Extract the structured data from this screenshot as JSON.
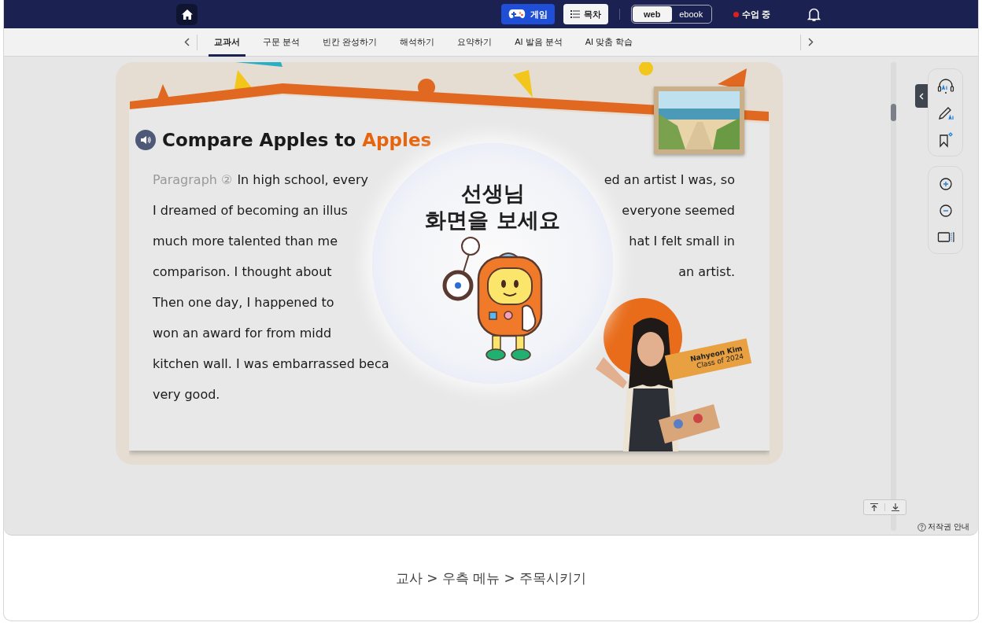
{
  "top_bar": {
    "game_button": "게임",
    "toc_button": "목차",
    "view_toggle": [
      {
        "label": "web",
        "selected": true
      },
      {
        "label": "ebook",
        "selected": false
      }
    ],
    "class_status": {
      "label": "수업 중",
      "live": true
    }
  },
  "tabs": [
    {
      "label": "교과서",
      "selected": true
    },
    {
      "label": "구문 분석",
      "selected": false
    },
    {
      "label": "빈칸 완성하기",
      "selected": false
    },
    {
      "label": "해석하기",
      "selected": false
    },
    {
      "label": "요약하기",
      "selected": false
    },
    {
      "label": "AI 발음 분석",
      "selected": false
    },
    {
      "label": "AI 맞춤 학습",
      "selected": false
    }
  ],
  "lesson": {
    "title": "Compare Apples to",
    "title_highlight": "Apples",
    "paragraph_label": "Paragraph ②",
    "lines": [
      {
        "left": "In high school, every",
        "right": "ed an artist I was, so"
      },
      {
        "left": "I dreamed of becoming an illus",
        "right": "everyone seemed"
      },
      {
        "left": "much more talented than me",
        "right": "hat I felt small in"
      },
      {
        "left": "comparison. I thought about",
        "right": "an artist."
      },
      {
        "left": "Then one day, I happened to"
      },
      {
        "left": "won an award for from midd"
      },
      {
        "left": "kitchen wall. I was embarrassed beca"
      },
      {
        "left": "very good."
      }
    ],
    "student_banner": {
      "name": "Nahyeon Kim",
      "class": "Class of 2024"
    }
  },
  "attention_overlay": {
    "message_lines": [
      "선생님",
      "화면을 보세요"
    ]
  },
  "copyright_link": "저작권 안내",
  "caption": "교사 > 우측 메뉴 > 주목시키기"
}
